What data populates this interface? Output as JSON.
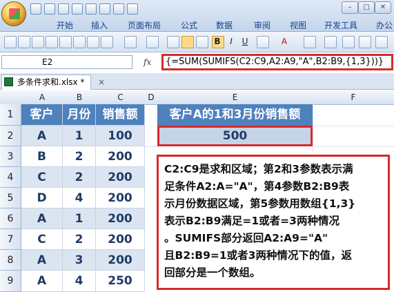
{
  "ribbon": {
    "tabs": [
      "开始",
      "插入",
      "页面布局",
      "公式",
      "数据",
      "审阅",
      "视图",
      "开发工具",
      "办公"
    ]
  },
  "formula_bar": {
    "name_box": "E2",
    "fx": "fx",
    "formula": "{=SUM(SUMIFS(C2:C9,A2:A9,\"A\",B2:B9,{1,3}))}"
  },
  "workbook": {
    "tab_title": "多条件求和.xlsx *",
    "close": "×"
  },
  "grid": {
    "columns": [
      "A",
      "B",
      "C",
      "D",
      "E",
      "F"
    ],
    "rows": [
      "1",
      "2",
      "3",
      "4",
      "5",
      "6",
      "7",
      "8",
      "9"
    ],
    "headers": [
      "客户",
      "月份",
      "销售额"
    ],
    "data": [
      [
        "A",
        "1",
        "100"
      ],
      [
        "B",
        "2",
        "200"
      ],
      [
        "C",
        "2",
        "200"
      ],
      [
        "D",
        "4",
        "200"
      ],
      [
        "A",
        "1",
        "200"
      ],
      [
        "C",
        "2",
        "200"
      ],
      [
        "A",
        "3",
        "200"
      ],
      [
        "A",
        "4",
        "250"
      ]
    ],
    "e1": "客户A的1和3月份销售额",
    "e2": "500"
  },
  "note": {
    "lines": [
      "C2:C9是求和区域；第2和3参数表示满",
      "足条件A2:A=\"A\"，第4参数B2:B9表",
      "示月份数据区域，第5参数用数组{1,3}",
      "表示B2:B9满足=1或者=3两种情况",
      "。SUMIFS部分返回A2:A9=\"A\"",
      "且B2:B9=1或者3两种情况下的值，返",
      "回部分是一个数组。"
    ]
  },
  "colors": {
    "header_blue": "#4f81bd",
    "band_blue": "#dbe5f1",
    "highlight_red": "#d62a2a"
  }
}
